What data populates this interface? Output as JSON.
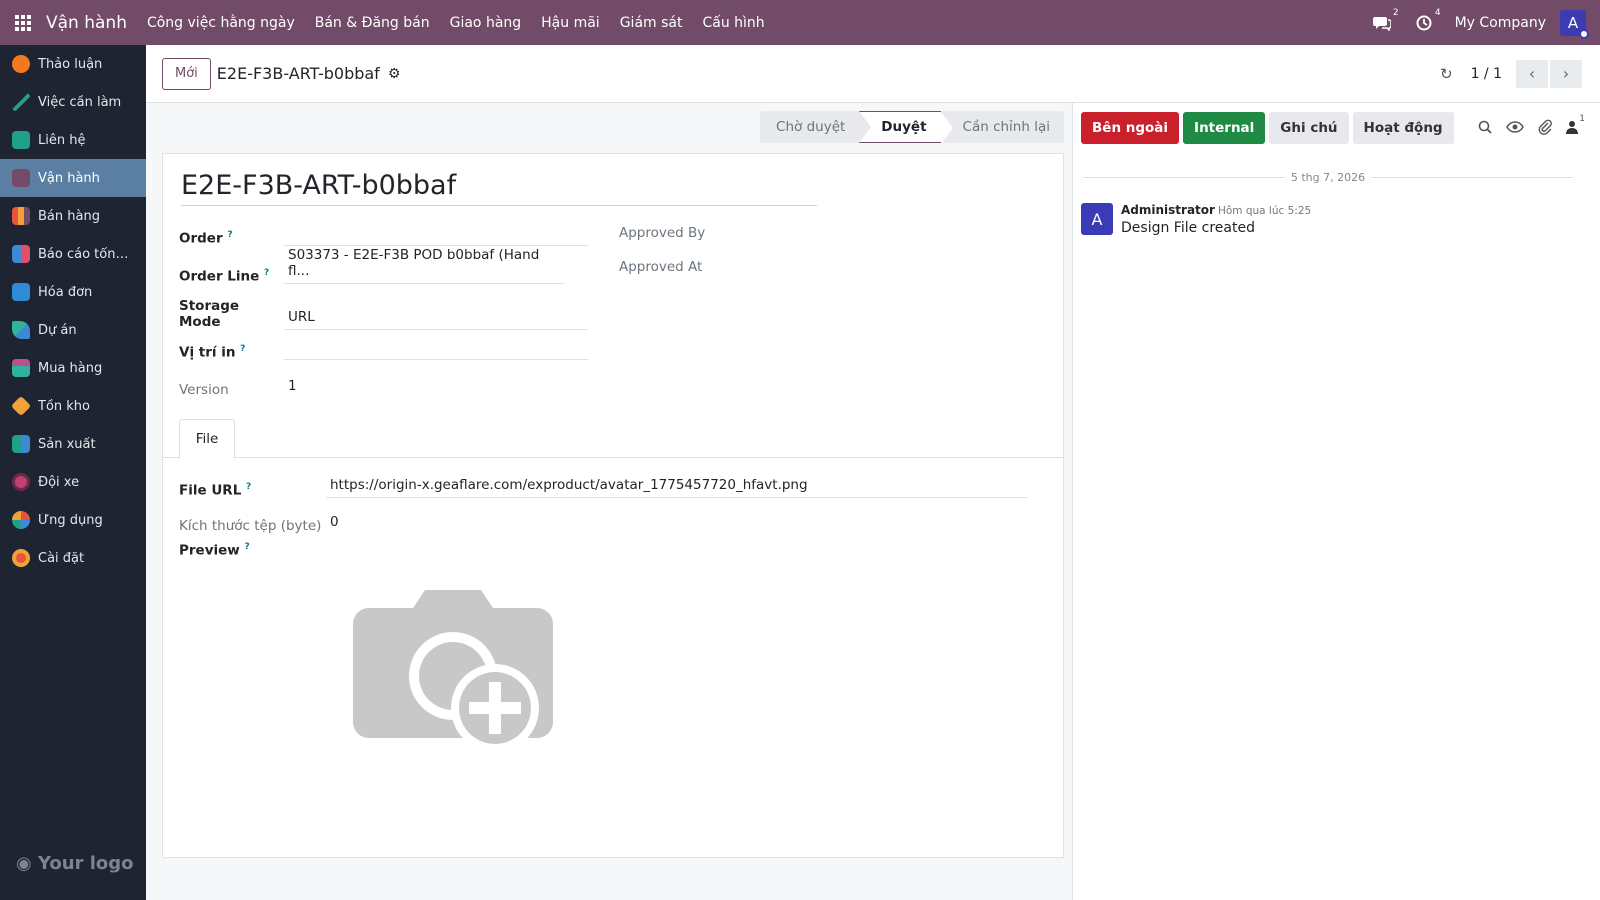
{
  "navbar": {
    "brand": "Vận hành",
    "menu": [
      "Công việc hằng ngày",
      "Bán & Đăng bán",
      "Giao hàng",
      "Hậu mãi",
      "Giám sát",
      "Cấu hình"
    ],
    "messages_badge": "2",
    "activities_badge": "4",
    "company": "My Company",
    "user_initial": "A"
  },
  "sidebar": {
    "items": [
      {
        "label": "Thảo luận",
        "color": "#f47a1f"
      },
      {
        "label": "Việc cần làm",
        "color": "#1fa08a"
      },
      {
        "label": "Liên hệ",
        "color": "#1fa08a"
      },
      {
        "label": "Vận hành",
        "color": "#714b67"
      },
      {
        "label": "Bán hàng",
        "color": "#e8543a"
      },
      {
        "label": "Báo cáo tổng ...",
        "color": "#e04f6b"
      },
      {
        "label": "Hóa đơn",
        "color": "#2e8bd6"
      },
      {
        "label": "Dự án",
        "color": "#2fb39f"
      },
      {
        "label": "Mua hàng",
        "color": "#b9508f"
      },
      {
        "label": "Tồn kho",
        "color": "#f0a13a"
      },
      {
        "label": "Sản xuất",
        "color": "#1fa08a"
      },
      {
        "label": "Đội xe",
        "color": "#c04070"
      },
      {
        "label": "Ứng dụng",
        "color": "#3c8ad6"
      },
      {
        "label": "Cài đặt",
        "color": "#e8543a"
      }
    ],
    "logo_text": "Your logo"
  },
  "control": {
    "new_label": "Mới",
    "record_title": "E2E-F3B-ART-b0bbaf",
    "pager": "1 / 1"
  },
  "statusbar": [
    "Chờ duyệt",
    "Duyệt",
    "Cần chỉnh lại"
  ],
  "form": {
    "name": "E2E-F3B-ART-b0bbaf",
    "order_label": "Order",
    "order_value": "",
    "order_line_label": "Order Line",
    "order_line_value": "S03373 - E2E-F3B POD b0bbaf (Hand fl...",
    "storage_mode_label": "Storage Mode",
    "storage_mode_value": "URL",
    "print_position_label": "Vị trí in",
    "print_position_value": "",
    "version_label": "Version",
    "version_value": "1",
    "approved_by_label": "Approved By",
    "approved_at_label": "Approved At",
    "tab_file": "File",
    "file_url_label": "File URL",
    "file_url_value": "https://origin-x.geaflare.com/exproduct/avatar_1775457720_hfavt.png",
    "file_size_label": "Kích thước tệp (byte)",
    "file_size_value": "0",
    "preview_label": "Preview",
    "help_mark": "?"
  },
  "chatter": {
    "buttons": [
      "Bên ngoài",
      "Internal",
      "Ghi chú",
      "Hoạt động"
    ],
    "followers_count": "1",
    "date": "5 thg 7, 2026",
    "message": {
      "author": "Administrator",
      "initial": "A",
      "time": "Hôm qua lúc 5:25",
      "text": "Design File created"
    }
  }
}
